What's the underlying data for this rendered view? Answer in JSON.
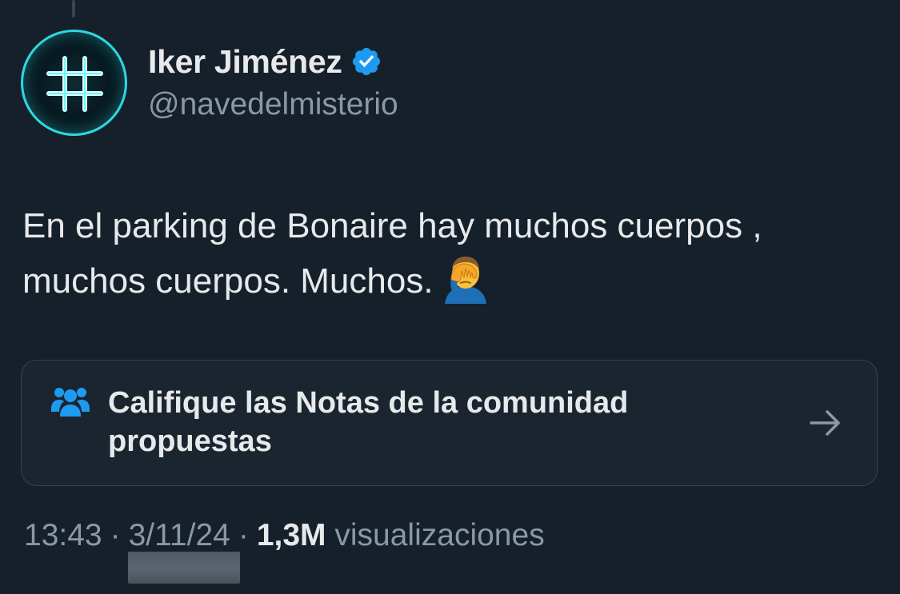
{
  "tweet": {
    "author": {
      "display_name": "Iker Jiménez",
      "handle": "@navedelmisterio",
      "verified": true,
      "avatar_icon": "hashtag-grid-icon"
    },
    "text_line1": "En el parking de Bonaire hay muchos cuerpos ,",
    "text_line2": "muchos cuerpos. Muchos.",
    "emoji": "face-palm-emoji",
    "community_notes": {
      "icon": "people-icon",
      "label": "Califique las Notas de la comunidad propuestas",
      "arrow_icon": "arrow-right-icon"
    },
    "meta": {
      "time": "13:43",
      "date": "3/11/24",
      "views_count": "1,3M",
      "views_label": "visualizaciones",
      "separator": "·"
    }
  },
  "colors": {
    "background": "#15202b",
    "text": "#e7e9ea",
    "secondary": "#8b98a5",
    "verified": "#1d9bf0",
    "accent_cyan": "#2fd6e0"
  }
}
